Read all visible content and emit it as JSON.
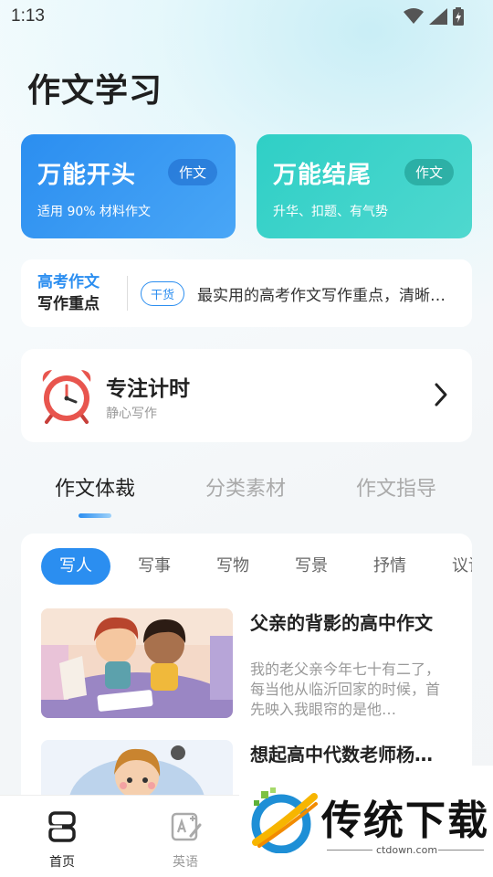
{
  "status_bar": {
    "time": "1:13"
  },
  "page_title": "作文学习",
  "cards": [
    {
      "title": "万能开头",
      "tag": "作文",
      "subtitle": "适用  90%  材料作文",
      "color": "#2b8ef0"
    },
    {
      "title": "万能结尾",
      "tag": "作文",
      "subtitle": "升华、扣题、有气势",
      "color": "#2fcfc6"
    }
  ],
  "news": {
    "label_line1": "高考作文",
    "label_line2": "写作重点",
    "badge": "干货",
    "text": "最实用的高考作文写作重点，清晰…"
  },
  "focus": {
    "title": "专注计时",
    "subtitle": "静心写作",
    "icon": "alarm-clock-icon"
  },
  "tabs": [
    {
      "label": "作文体裁",
      "active": true
    },
    {
      "label": "分类素材",
      "active": false
    },
    {
      "label": "作文指导",
      "active": false
    }
  ],
  "chips": [
    "写人",
    "写事",
    "写物",
    "写景",
    "抒情",
    "议论"
  ],
  "articles": [
    {
      "title": "父亲的背影的高中作文",
      "desc": "我的老父亲今年七十有二了，每当他从临沂回家的时候，首先映入我眼帘的是他…"
    },
    {
      "title": "想起高中代数老师杨…",
      "desc": ""
    }
  ],
  "bottom_nav": [
    {
      "label": "首页",
      "icon": "home-icon",
      "active": true
    },
    {
      "label": "英语",
      "icon": "english-edit-icon",
      "active": false
    }
  ],
  "watermark": {
    "text": "传统下载",
    "sub": "ctdown.com"
  }
}
